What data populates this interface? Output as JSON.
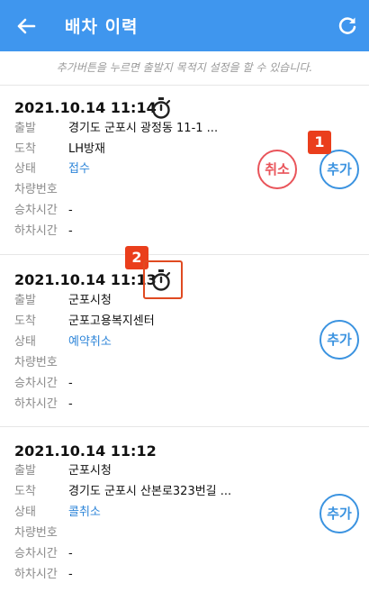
{
  "header": {
    "title": "배차 이력",
    "back_icon": "arrow-left-icon",
    "refresh_icon": "refresh-icon"
  },
  "hint": "추가버튼을 누르면 출발지 목적지 설정을 할 수 있습니다.",
  "labels": {
    "departure": "출발",
    "arrival": "도착",
    "status": "상태",
    "vehicle": "차량번호",
    "boarding": "승차시간",
    "alighting": "하차시간"
  },
  "records": [
    {
      "datetime": "2021.10.14 11:14",
      "departure": "경기도 군포시 광정동 11-1 ...",
      "arrival": "LH방재",
      "status": "접수",
      "vehicle": "",
      "boarding": "-",
      "alighting": "-",
      "cancel_label": "취소",
      "add_label": "추가"
    },
    {
      "datetime": "2021.10.14 11:13",
      "departure": "군포시청",
      "arrival": "군포고용복지센터",
      "status": "예약취소",
      "vehicle": "",
      "boarding": "-",
      "alighting": "-",
      "add_label": "추가"
    },
    {
      "datetime": "2021.10.14 11:12",
      "departure": "군포시청",
      "arrival": "경기도 군포시 산본로323번길 ...",
      "status": "콜취소",
      "vehicle": "",
      "boarding": "-",
      "alighting": "-",
      "add_label": "추가"
    }
  ],
  "annotations": {
    "badge1": "1",
    "badge2": "2"
  },
  "colors": {
    "appbar": "#3f96ee",
    "accent_blue": "#3b93e0",
    "cancel_red": "#e9545a",
    "badge": "#ea3e1c"
  }
}
